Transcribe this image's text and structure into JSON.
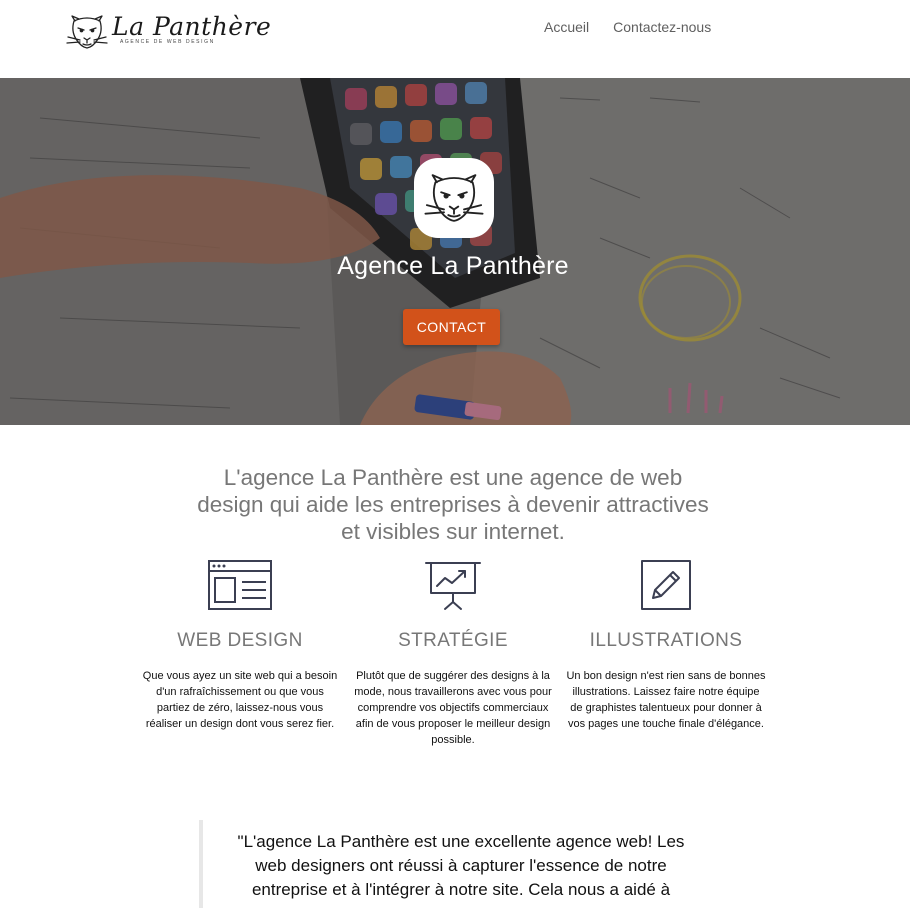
{
  "header": {
    "logo": {
      "name": "La Panthère",
      "subtitle": "AGENCE DE WEB DESIGN",
      "icon": "panther-head-icon"
    },
    "nav": [
      {
        "label": "Accueil"
      },
      {
        "label": "Contactez-nous"
      }
    ]
  },
  "hero": {
    "logo_icon": "panther-head-icon",
    "title": "Agence La Panthère",
    "cta_label": "CONTACT",
    "cta_color": "#d2521a"
  },
  "intro": {
    "text": "L'agence La Panthère est une agence de web design qui aide les entreprises à devenir attractives et visibles sur internet."
  },
  "features": [
    {
      "icon": "browser-window-icon",
      "title": "WEB DESIGN",
      "text": "Que vous ayez un site web qui a besoin d'un rafraîchissement ou que vous partiez de zéro, laissez-nous vous réaliser un design dont vous serez fier."
    },
    {
      "icon": "presentation-chart-icon",
      "title": "STRATÉGIE",
      "text": "Plutôt que de suggérer des designs à la mode, nous travaillerons avec vous pour comprendre vos objectifs commerciaux afin de vous proposer le meilleur design possible."
    },
    {
      "icon": "pencil-square-icon",
      "title": "ILLUSTRATIONS",
      "text": "Un bon design n'est rien sans de bonnes illustrations. Laissez faire notre équipe de graphistes talentueux pour donner à vos pages une touche finale d'élégance."
    }
  ],
  "testimonial": {
    "text": "\"L'agence La Panthère est une excellente agence web! Les web designers ont réussi à capturer l'essence de notre entreprise et à l'intégrer à notre site. Cela nous a aidé à"
  }
}
